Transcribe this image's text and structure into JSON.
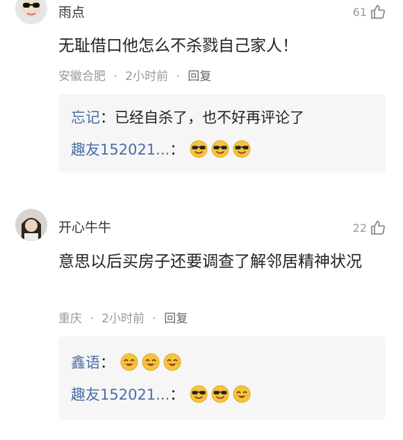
{
  "comments": [
    {
      "username": "雨点",
      "likes": "61",
      "text": "无耻借口他怎么不杀戮自己家人！",
      "location": "安徽合肥",
      "separator": "·",
      "time": "2小时前",
      "reply_label": "回复",
      "replies": [
        {
          "author": "忘记",
          "colon": "：",
          "content": "已经自杀了，也不好再评论了",
          "emojis": []
        },
        {
          "author": "趣友152021...",
          "colon": "：",
          "content": "",
          "emojis": [
            "sunglasses-emoji",
            "sunglasses-emoji",
            "sunglasses-emoji"
          ]
        }
      ]
    },
    {
      "username": "开心牛牛",
      "likes": "22",
      "text": "意思以后买房子还要调查了解邻居精神状况",
      "location": "重庆",
      "separator": "·",
      "time": "2小时前",
      "reply_label": "回复",
      "replies": [
        {
          "author": "鑫语",
          "colon": "：",
          "content": "",
          "emojis": [
            "smile-emoji",
            "smile-emoji",
            "smile-emoji"
          ]
        },
        {
          "author": "趣友152021...",
          "colon": "：",
          "content": "",
          "emojis": [
            "sunglasses-emoji",
            "sunglasses-emoji",
            "smile-emoji"
          ]
        }
      ]
    }
  ],
  "colors": {
    "reply_author": "#4a6fa5",
    "meta": "#999999",
    "reply_box": "#f6f6f6",
    "emoji_face": "#f7c33c"
  }
}
